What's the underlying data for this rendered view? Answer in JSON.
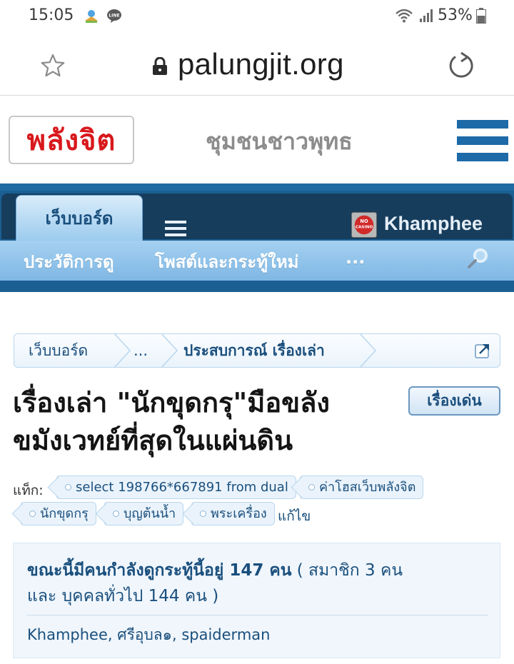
{
  "status_bar": {
    "time": "15:05",
    "battery": "53%",
    "icons": [
      "travel-app-icon",
      "line-app-icon",
      "wifi-icon",
      "signal-icon",
      "battery-icon"
    ]
  },
  "browser": {
    "url": "palungjit.org",
    "icons": [
      "star-icon",
      "lock-icon",
      "reload-icon"
    ]
  },
  "site": {
    "logo_text": "พลังจิต",
    "slogan": "ชุมชนชาวพุทธ",
    "menu_icon": "hamburger-icon",
    "accent_color": "#1d6aa8",
    "logo_color": "#d8181c"
  },
  "forum_nav": {
    "tab_label": "เว็บบอร์ด",
    "username": "Khamphee",
    "links": [
      "ประวัติการดู",
      "โพสต์และกระทู้ใหม่",
      "..."
    ],
    "icons": [
      "menu-icon",
      "no-casino-avatar-icon",
      "search-icon"
    ]
  },
  "breadcrumb": {
    "items": [
      "เว็บบอร์ด",
      "...",
      "ประสบการณ์ เรื่องเล่า"
    ],
    "icon": "external-link-icon"
  },
  "thread": {
    "title_line1": "เรื่องเล่า \"นักขุดกรุ\"มือขลัง",
    "title_line2": "ขมังเวทย์ที่สุดในแผ่นดิน",
    "prefix": "เรื่องเด่น"
  },
  "tags": {
    "label": "แท็ก:",
    "items": [
      "select 198766*667891 from dual",
      "ค่าโฮสเว็บพลังจิต",
      "นักขุดกรุ",
      "บุญต้นน้ำ",
      "พระเครื่อง"
    ],
    "edit_label": "แก้ไข"
  },
  "viewers": {
    "headline": "ขณะนี้มีคนกำลังดูกระทู้นี้อยู่ 147 คน",
    "detail_line1": " ( สมาชิก 3 คน",
    "detail_line2": "และ บุคคลทั่วไป 144 คน )",
    "names": "Khamphee, ศรีอุบล๑, spaiderman"
  }
}
